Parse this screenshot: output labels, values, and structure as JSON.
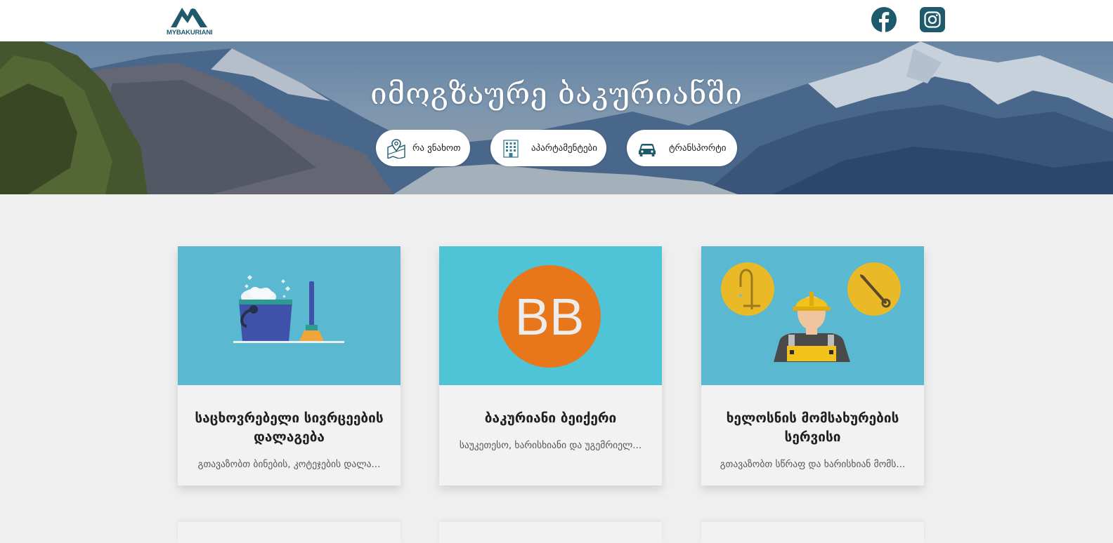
{
  "header": {
    "logo_text": "MYBAKURIANI",
    "social": [
      {
        "icon": "facebook-icon",
        "color": "#1e5a6c"
      },
      {
        "icon": "instagram-icon",
        "color": "#1e5a6c"
      }
    ]
  },
  "hero": {
    "title": "იმოგზაურე ბაკურიანში",
    "buttons": [
      {
        "label": "რა ვნახოთ",
        "icon": "map-pin-icon"
      },
      {
        "label": "აპარტამენტები",
        "icon": "building-icon"
      },
      {
        "label": "ტრანსპორტი",
        "icon": "car-icon"
      }
    ]
  },
  "cards": [
    {
      "title": "საცხოვრებელი სივრცეების დალაგება",
      "description": "გთავაზობთ ბინების, კოტეჯების დალა...",
      "image_icon": "cleaning-bucket-icon",
      "color": "#5ab9d0"
    },
    {
      "title": "ბაკურიანი ბეიქერი",
      "description": "საუკეთესო, ხარისხიანი და უგემრიელ...",
      "image_text": "BB",
      "color": "#4fc4d6"
    },
    {
      "title": "ხელოსნის მომსახურების სერვისი",
      "description": "გთავაზობთ სწრაფ და ხარისხიან მომს...",
      "image_icon": "handyman-icon",
      "color": "#5ab9d0"
    }
  ],
  "colors": {
    "brand": "#1e5a6c",
    "page_background": "#efefef",
    "bb_orange": "#e8761a",
    "tool_gold": "#e9b927"
  }
}
